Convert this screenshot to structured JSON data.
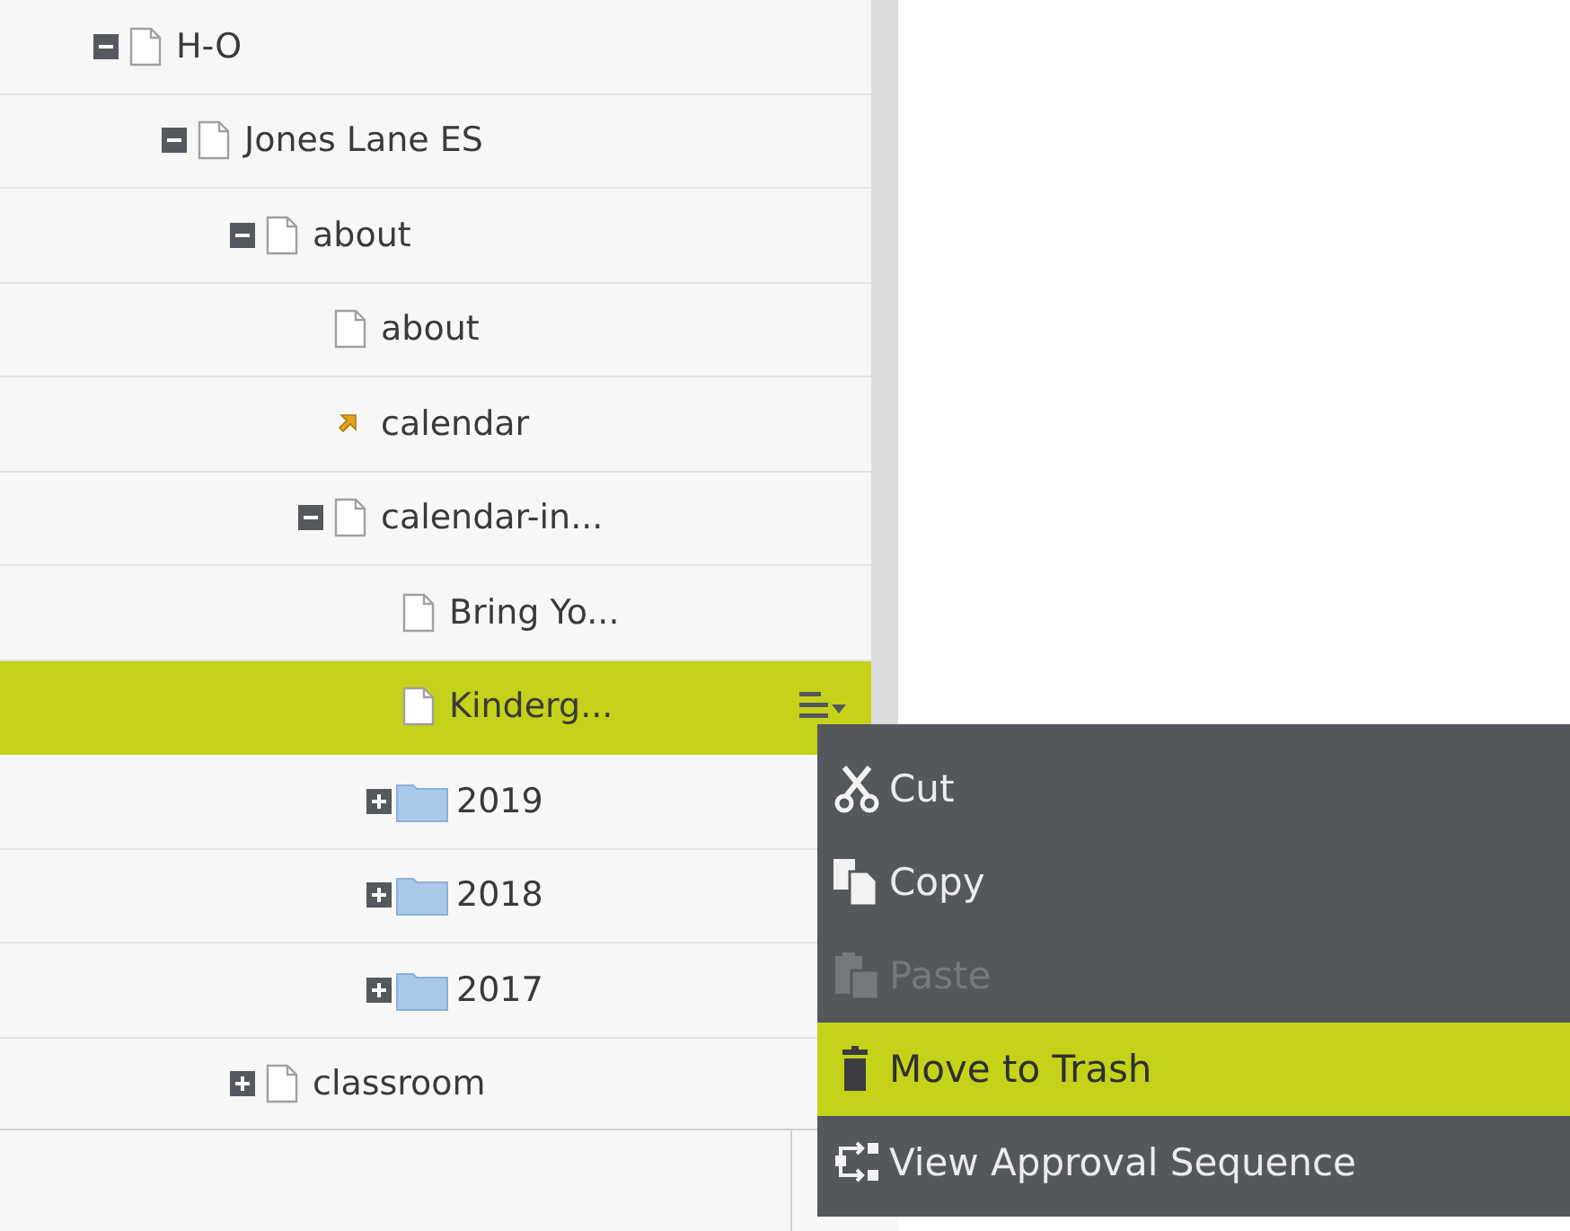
{
  "tree": [
    {
      "label": "H-O",
      "kind": "page",
      "expanded": true,
      "selected": false,
      "children": [
        {
          "label": "Jones Lane ES",
          "kind": "page",
          "expanded": true,
          "selected": false,
          "children": [
            {
              "label": "about",
              "kind": "page",
              "expanded": true,
              "selected": false,
              "children": [
                {
                  "label": "about",
                  "kind": "page",
                  "selected": false
                },
                {
                  "label": "calendar",
                  "kind": "link",
                  "selected": false
                },
                {
                  "label": "calendar-in...",
                  "kind": "page",
                  "expanded": true,
                  "selected": false,
                  "children": [
                    {
                      "label": "Bring Yo...",
                      "kind": "page",
                      "selected": false
                    },
                    {
                      "label": "Kinderg...",
                      "kind": "page",
                      "selected": true
                    },
                    {
                      "label": "2019",
                      "kind": "folder",
                      "expanded": false,
                      "selected": false
                    },
                    {
                      "label": "2018",
                      "kind": "folder",
                      "expanded": false,
                      "selected": false
                    },
                    {
                      "label": "2017",
                      "kind": "folder",
                      "expanded": false,
                      "selected": false
                    }
                  ]
                }
              ]
            },
            {
              "label": "classroom",
              "kind": "page",
              "expanded": false,
              "selected": false
            }
          ]
        }
      ]
    }
  ],
  "context_menu": [
    {
      "label": "Cut",
      "kind": "cut",
      "disabled": false,
      "selected": false
    },
    {
      "label": "Copy",
      "kind": "copy",
      "disabled": false,
      "selected": false
    },
    {
      "label": "Paste",
      "kind": "paste",
      "disabled": true,
      "selected": false
    },
    {
      "label": "Move to Trash",
      "kind": "trash",
      "disabled": false,
      "selected": true
    },
    {
      "label": "View Approval Sequence",
      "kind": "approval",
      "disabled": false,
      "selected": false
    }
  ]
}
